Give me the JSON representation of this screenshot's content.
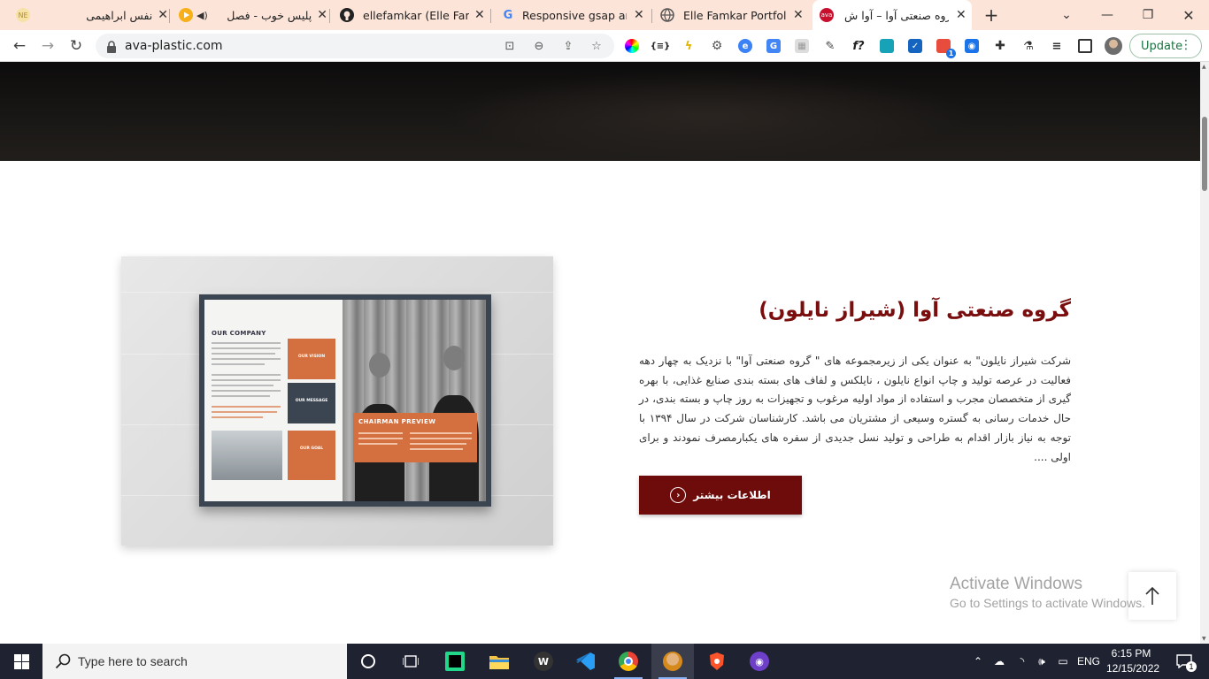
{
  "browser": {
    "tabs": [
      {
        "title": "نفس ابراهیمی",
        "favicon": "ne-favicon"
      },
      {
        "title": "پلیس خوب - فصل",
        "favicon": "play-favicon"
      },
      {
        "title": "ellefamkar (Elle Famka",
        "favicon": "github-favicon"
      },
      {
        "title": "Responsive gsap anim",
        "favicon": "google-favicon"
      },
      {
        "title": "Elle Famkar Portfolio |",
        "favicon": "globe-favicon"
      },
      {
        "title": "گروه صنعتی آوا – آوا ش",
        "favicon": "ava-favicon",
        "active": true
      }
    ],
    "url": "ava-plastic.com",
    "update_label": "Update",
    "extensions_badge": "1"
  },
  "page": {
    "section_title": "گروه صنعتی آوا (شیراز نایلون)",
    "section_body": "شرکت شیراز نایلون\" به عنوان یکی از زیرمجموعه های \" گروه صنعتی آوا\" با نزدیک به چهار دهه فعالیت در عرصه تولید و چاپ انواع نایلون ، نایلکس و لفاف های بسته بندی صنایع غذایی، با بهره گیری از متخصصان مجرب و استفاده از مواد اولیه مرغوب و تجهیزات به روز چاپ و بسته بندی، در حال خدمات رسانی به گستره وسیعی از مشتریان می باشد. کارشناسان شرکت در سال ۱۳۹۴ با توجه به نیاز بازار اقدام به طراحی و تولید نسل جدیدی از سفره های یکبارمصرف نمودند و برای اولی ....",
    "more_button": "اطلاعات بیشتر",
    "brochure": {
      "left_title": "OUR COMPANY",
      "right_title": "CHAIRMAN PREVIEW",
      "box_labels": [
        "OUR VISION",
        "OUR MESSAGE",
        "OUR GOAL"
      ]
    }
  },
  "watermark": {
    "line1": "Activate Windows",
    "line2": "Go to Settings to activate Windows."
  },
  "taskbar": {
    "search_placeholder": "Type here to search",
    "language": "ENG",
    "time": "6:15 PM",
    "date": "12/15/2022",
    "notification_count": "1"
  },
  "colors": {
    "brand": "#6e0b0b",
    "title": "#7a0d0d",
    "tab_strip": "#fde4d8",
    "taskbar": "#1f2230"
  }
}
